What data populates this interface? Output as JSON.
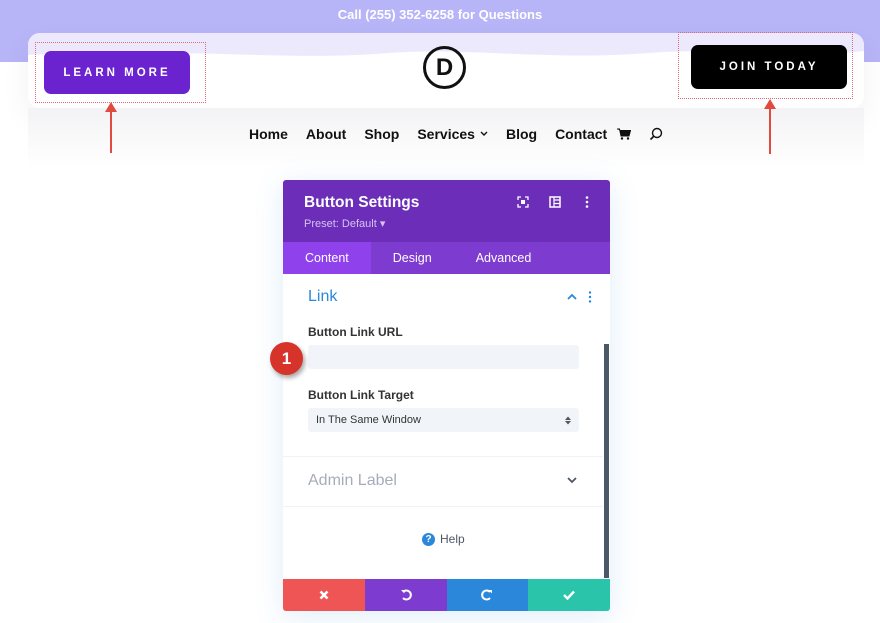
{
  "topbar": {
    "text": "Call (255) 352-6258 for Questions"
  },
  "header": {
    "learn_more_label": "LEARN MORE",
    "join_today_label": "JOIN TODAY",
    "logo_letter": "D"
  },
  "nav": {
    "items": [
      {
        "label": "Home"
      },
      {
        "label": "About"
      },
      {
        "label": "Shop"
      },
      {
        "label": "Services",
        "chevron": "⌄"
      },
      {
        "label": "Blog"
      },
      {
        "label": "Contact"
      }
    ],
    "icons": [
      "cart-icon",
      "search-icon"
    ]
  },
  "panel": {
    "title": "Button Settings",
    "preset": "Preset: Default ▾",
    "header_icons": [
      "focus-icon",
      "split-view-icon",
      "more-icon"
    ],
    "tabs": [
      {
        "label": "Content",
        "active": true
      },
      {
        "label": "Design",
        "active": false
      },
      {
        "label": "Advanced",
        "active": false
      }
    ],
    "sections": {
      "link": {
        "title": "Link",
        "url_label": "Button Link URL",
        "url_value": "",
        "target_label": "Button Link Target",
        "target_value": "In The Same Window"
      },
      "admin": {
        "title": "Admin Label"
      }
    },
    "help_label": "Help",
    "footer": {
      "cancel": "✖",
      "undo": "↺",
      "redo": "↻",
      "save": "✔"
    }
  },
  "annotation": {
    "step": "1"
  },
  "colors": {
    "topbar": "#b8b4f8",
    "learn_more": "#6b22cf",
    "join_today": "#000000",
    "panel_header": "#6c2eb9",
    "tab_bar": "#7d3bcf",
    "tab_active": "#8f42ec",
    "link_blue": "#2b87da",
    "cancel": "#ef5555",
    "undo": "#7e3bd0",
    "redo": "#2b87da",
    "save": "#29c4a9",
    "badge": "#d6332a"
  }
}
